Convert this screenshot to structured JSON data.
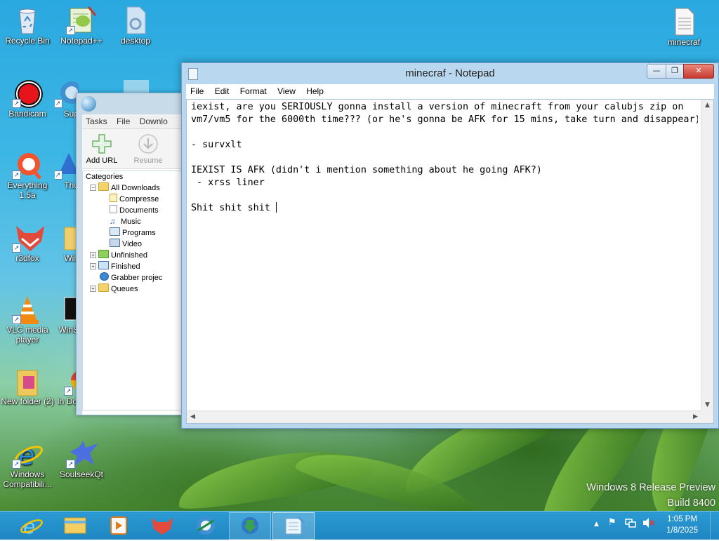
{
  "desktop": {
    "icons": [
      {
        "label": "Recycle Bin",
        "icon": "recycle-bin-icon"
      },
      {
        "label": "Notepad++",
        "icon": "notepad-plus-plus-icon"
      },
      {
        "label": "desktop",
        "icon": "file-icon"
      },
      {
        "label": "minecraf",
        "icon": "text-file-icon"
      },
      {
        "label": "Bandicam",
        "icon": "bandicam-icon"
      },
      {
        "label": "Sup",
        "icon": "browser-icon"
      },
      {
        "label": "Everything 1.5a",
        "icon": "everything-search-icon"
      },
      {
        "label": "Thu",
        "icon": "thunderbird-icon"
      },
      {
        "label": "r3dfox",
        "icon": "r3dfox-icon"
      },
      {
        "label": "Win",
        "icon": "folder-icon"
      },
      {
        "label": "VLC media player",
        "icon": "vlc-icon"
      },
      {
        "label": "WinS",
        "icon": "app-icon"
      },
      {
        "label": "New folder (2)",
        "icon": "folder-icon"
      },
      {
        "label": "In Downlo...",
        "icon": "chrome-icon"
      },
      {
        "label": "Windows Compatibili...",
        "icon": "internet-explorer-icon"
      },
      {
        "label": "SoulseekQt",
        "icon": "soulseek-bird-icon"
      }
    ]
  },
  "idm": {
    "menu": [
      "Tasks",
      "File",
      "Downlo"
    ],
    "toolbar": [
      {
        "label": "Add URL",
        "icon": "plus-icon"
      },
      {
        "label": "Resume",
        "icon": "download-arrow-icon"
      }
    ],
    "categories_label": "Categories",
    "tree": [
      {
        "label": "All Downloads",
        "level": 0,
        "expander": "−",
        "icon": "open-folder-icon"
      },
      {
        "label": "Compresse",
        "level": 1,
        "icon": "zip-icon"
      },
      {
        "label": "Documents",
        "level": 1,
        "icon": "document-icon"
      },
      {
        "label": "Music",
        "level": 1,
        "icon": "music-note-icon"
      },
      {
        "label": "Programs",
        "level": 1,
        "icon": "window-icon"
      },
      {
        "label": "Video",
        "level": 1,
        "icon": "film-icon"
      },
      {
        "label": "Unfinished",
        "level": 0,
        "expander": "+",
        "icon": "folder-download-icon"
      },
      {
        "label": "Finished",
        "level": 0,
        "expander": "+",
        "icon": "checked-folder-icon"
      },
      {
        "label": "Grabber projec",
        "level": 0,
        "icon": "globe-icon"
      },
      {
        "label": "Queues",
        "level": 0,
        "expander": "+",
        "icon": "folder-icon"
      }
    ]
  },
  "notepad": {
    "title": "minecraf - Notepad",
    "controls": {
      "minimize": "—",
      "maximize": "❐",
      "close": "✕"
    },
    "menu": [
      "File",
      "Edit",
      "Format",
      "View",
      "Help"
    ],
    "lines": [
      "iexist, are you SERIOUSLY gonna install a version of minecraft from your calubjs zip on",
      "vm7/vm5 for the 6000th time??? (or he's gonna be AFK for 15 mins, take turn and disappear)",
      "",
      "- survxlt",
      "",
      "IEXIST IS AFK (didn't i mention something about he going AFK?)",
      " - xrss liner",
      "",
      "Shit shit shit "
    ]
  },
  "watermark": {
    "line1": "Windows 8 Release Preview",
    "line2": "Build 8400"
  },
  "taskbar": {
    "apps": [
      {
        "name": "internet-explorer",
        "state": "normal"
      },
      {
        "name": "file-explorer",
        "state": "normal"
      },
      {
        "name": "media-player",
        "state": "normal"
      },
      {
        "name": "r3dfox",
        "state": "normal"
      },
      {
        "name": "browser",
        "state": "normal"
      },
      {
        "name": "internet-download-manager",
        "state": "running"
      },
      {
        "name": "notepad",
        "state": "active"
      }
    ],
    "tray": {
      "chevron": "▲",
      "flag": "⚑",
      "network": "network-icon",
      "volume": "muted-speaker-icon"
    },
    "clock": {
      "time": "1:05 PM",
      "date": "1/8/2025"
    }
  },
  "colors": {
    "taskbar": "#1e86c2",
    "notepad_frame": "#b9d7ee",
    "close_button": "#c7372f"
  }
}
